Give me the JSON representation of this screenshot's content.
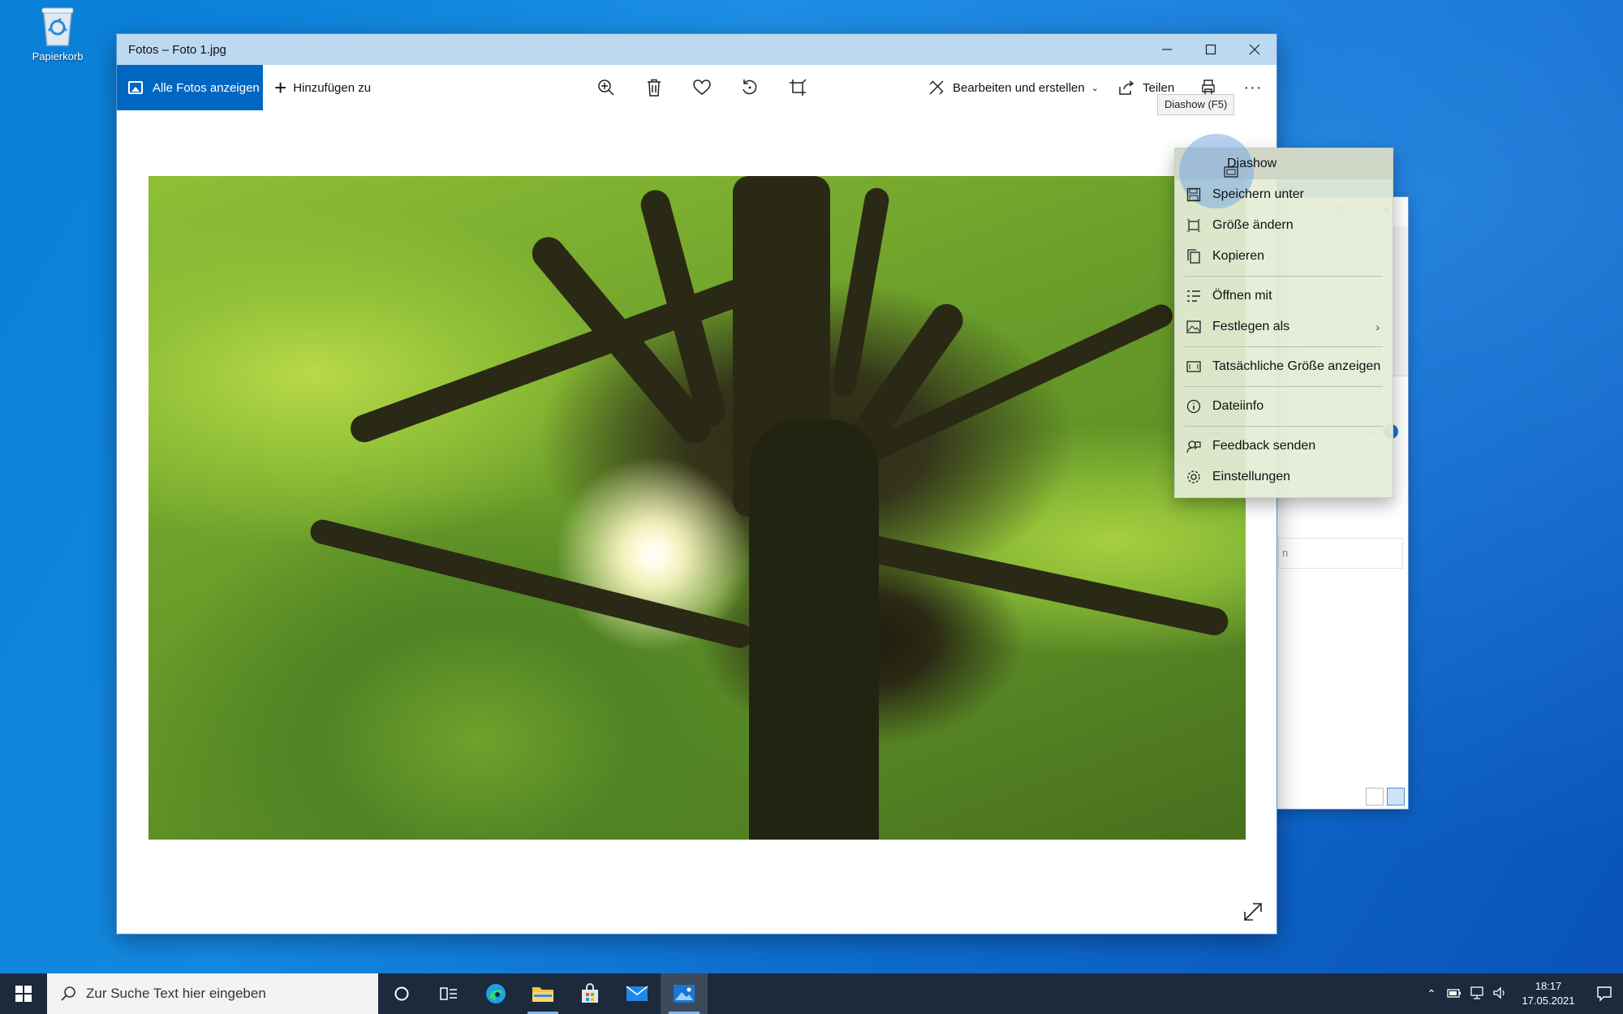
{
  "desktop": {
    "recycle_bin_label": "Papierkorb"
  },
  "photos_window": {
    "title": "Fotos – Foto 1.jpg",
    "toolbar": {
      "all_photos_label": "Alle Fotos anzeigen",
      "add_to_label": "Hinzufügen zu",
      "edit_create_label": "Bearbeiten und erstellen",
      "share_label": "Teilen"
    },
    "tooltip": "Diashow (F5)"
  },
  "context_menu": {
    "items": [
      {
        "label": "Diashow",
        "icon": "slideshow-icon"
      },
      {
        "label": "Speichern unter",
        "icon": "save-icon"
      },
      {
        "label": "Größe ändern",
        "icon": "resize-icon"
      },
      {
        "label": "Kopieren",
        "icon": "copy-icon"
      },
      {
        "label": "Öffnen mit",
        "icon": "open-with-icon"
      },
      {
        "label": "Festlegen als",
        "icon": "set-as-icon"
      },
      {
        "label": "Tatsächliche Größe anzeigen",
        "icon": "actual-size-icon"
      },
      {
        "label": "Dateiinfo",
        "icon": "info-icon"
      },
      {
        "label": "Feedback senden",
        "icon": "feedback-icon"
      },
      {
        "label": "Einstellungen",
        "icon": "settings-icon"
      }
    ]
  },
  "taskbar": {
    "search_placeholder": "Zur Suche Text hier eingeben",
    "time": "18:17",
    "date": "17.05.2021"
  },
  "colors": {
    "accent": "#0067c0",
    "titlebar": "#bcd9f1",
    "taskbar": "#1c2a3c"
  }
}
